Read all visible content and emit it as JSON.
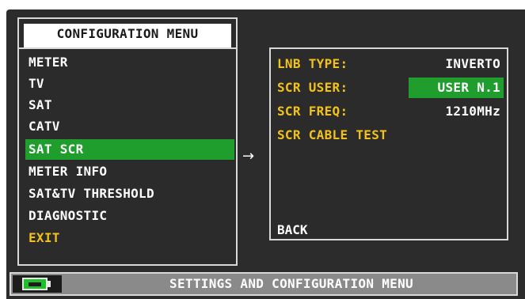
{
  "menu": {
    "title": "CONFIGURATION MENU",
    "items": [
      {
        "label": "METER"
      },
      {
        "label": "TV"
      },
      {
        "label": "SAT"
      },
      {
        "label": "CATV"
      },
      {
        "label": "SAT SCR",
        "selected": true
      },
      {
        "label": "METER INFO"
      },
      {
        "label": "SAT&TV THRESHOLD"
      },
      {
        "label": "DIAGNOSTIC"
      },
      {
        "label": "EXIT"
      }
    ]
  },
  "arrow": "→",
  "panel": {
    "lnb_type_label": "LNB TYPE:",
    "lnb_type_value": "INVERTO",
    "scr_user_label": "SCR USER:",
    "scr_user_value": "USER N.1",
    "scr_freq_label": "SCR FREQ:",
    "scr_freq_value": "1210MHz",
    "scr_cable_test_label": "SCR CABLE TEST",
    "back_label": "BACK"
  },
  "status_bar": {
    "text": "SETTINGS AND CONFIGURATION MENU",
    "battery_icon": "battery-charging-icon"
  },
  "colors": {
    "background": "#2c2c2c",
    "highlight": "#1f9e2d",
    "accent_yellow": "#f2c21b",
    "text": "#ffffff",
    "status_bar": "#8a8a8a"
  }
}
